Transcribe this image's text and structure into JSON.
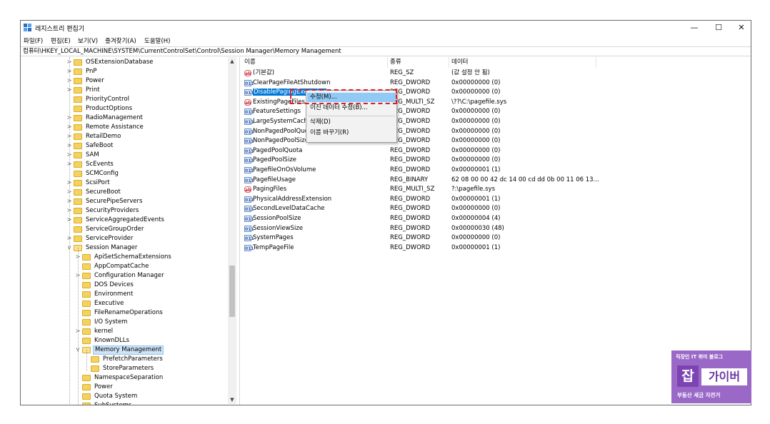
{
  "window": {
    "title": "레지스트리 편집기",
    "minimize": "—",
    "maximize": "☐",
    "close": "✕"
  },
  "menu": [
    "파일(F)",
    "편집(E)",
    "보기(V)",
    "즐겨찾기(A)",
    "도움말(H)"
  ],
  "address": "컴퓨터\\HKEY_LOCAL_MACHINE\\SYSTEM\\CurrentControlSet\\Control\\Session Manager\\Memory Management",
  "tree": [
    {
      "label": "OSExtensionDatabase",
      "level": 0,
      "chevron": ">"
    },
    {
      "label": "PnP",
      "level": 0,
      "chevron": ">"
    },
    {
      "label": "Power",
      "level": 0,
      "chevron": ">"
    },
    {
      "label": "Print",
      "level": 0,
      "chevron": ">"
    },
    {
      "label": "PriorityControl",
      "level": 0,
      "chevron": ""
    },
    {
      "label": "ProductOptions",
      "level": 0,
      "chevron": ""
    },
    {
      "label": "RadioManagement",
      "level": 0,
      "chevron": ">"
    },
    {
      "label": "Remote Assistance",
      "level": 0,
      "chevron": ">"
    },
    {
      "label": "RetailDemo",
      "level": 0,
      "chevron": ">"
    },
    {
      "label": "SafeBoot",
      "level": 0,
      "chevron": ">"
    },
    {
      "label": "SAM",
      "level": 0,
      "chevron": ">"
    },
    {
      "label": "ScEvents",
      "level": 0,
      "chevron": ">"
    },
    {
      "label": "SCMConfig",
      "level": 0,
      "chevron": ""
    },
    {
      "label": "ScsiPort",
      "level": 0,
      "chevron": ">"
    },
    {
      "label": "SecureBoot",
      "level": 0,
      "chevron": ">"
    },
    {
      "label": "SecurePipeServers",
      "level": 0,
      "chevron": ">"
    },
    {
      "label": "SecurityProviders",
      "level": 0,
      "chevron": ">"
    },
    {
      "label": "ServiceAggregatedEvents",
      "level": 0,
      "chevron": ">"
    },
    {
      "label": "ServiceGroupOrder",
      "level": 0,
      "chevron": ""
    },
    {
      "label": "ServiceProvider",
      "level": 0,
      "chevron": ">"
    },
    {
      "label": "Session Manager",
      "level": 0,
      "chevron": "v",
      "open": true
    },
    {
      "label": "ApiSetSchemaExtensions",
      "level": 1,
      "chevron": ">"
    },
    {
      "label": "AppCompatCache",
      "level": 1,
      "chevron": ""
    },
    {
      "label": "Configuration Manager",
      "level": 1,
      "chevron": ">"
    },
    {
      "label": "DOS Devices",
      "level": 1,
      "chevron": ""
    },
    {
      "label": "Environment",
      "level": 1,
      "chevron": ""
    },
    {
      "label": "Executive",
      "level": 1,
      "chevron": ""
    },
    {
      "label": "FileRenameOperations",
      "level": 1,
      "chevron": ""
    },
    {
      "label": "I/O System",
      "level": 1,
      "chevron": ""
    },
    {
      "label": "kernel",
      "level": 1,
      "chevron": ">"
    },
    {
      "label": "KnownDLLs",
      "level": 1,
      "chevron": ""
    },
    {
      "label": "Memory Management",
      "level": 1,
      "chevron": "v",
      "open": true,
      "selected": true
    },
    {
      "label": "PrefetchParameters",
      "level": 2,
      "chevron": ""
    },
    {
      "label": "StoreParameters",
      "level": 2,
      "chevron": ""
    },
    {
      "label": "NamespaceSeparation",
      "level": 1,
      "chevron": ""
    },
    {
      "label": "Power",
      "level": 1,
      "chevron": ""
    },
    {
      "label": "Quota System",
      "level": 1,
      "chevron": ""
    },
    {
      "label": "SubSystems",
      "level": 1,
      "chevron": ""
    }
  ],
  "columns": {
    "name": "이름",
    "type": "종류",
    "data": "데이터"
  },
  "values": [
    {
      "icon": "ab",
      "name": "(기본값)",
      "type": "REG_SZ",
      "data": "(값 설정 안 됨)"
    },
    {
      "icon": "bin",
      "name": "ClearPageFileAtShutdown",
      "type": "REG_DWORD",
      "data": "0x00000000 (0)"
    },
    {
      "icon": "bin",
      "name": "DisablePagingExecutive",
      "type": "REG_DWORD",
      "data": "0x00000000 (0)",
      "selected": true
    },
    {
      "icon": "ab",
      "name": "ExistingPageFiles",
      "type": "REG_MULTI_SZ",
      "data": "\\??\\C:\\pagefile.sys"
    },
    {
      "icon": "bin",
      "name": "FeatureSettings",
      "type": "REG_DWORD",
      "data": "0x00000000 (0)"
    },
    {
      "icon": "bin",
      "name": "LargeSystemCache",
      "type": "REG_DWORD",
      "data": "0x00000000 (0)"
    },
    {
      "icon": "bin",
      "name": "NonPagedPoolQuota",
      "type": "REG_DWORD",
      "data": "0x00000000 (0)"
    },
    {
      "icon": "bin",
      "name": "NonPagedPoolSize",
      "type": "REG_DWORD",
      "data": "0x00000000 (0)"
    },
    {
      "icon": "bin",
      "name": "PagedPoolQuota",
      "type": "REG_DWORD",
      "data": "0x00000000 (0)"
    },
    {
      "icon": "bin",
      "name": "PagedPoolSize",
      "type": "REG_DWORD",
      "data": "0x00000000 (0)"
    },
    {
      "icon": "bin",
      "name": "PagefileOnOsVolume",
      "type": "REG_DWORD",
      "data": "0x00000001 (1)"
    },
    {
      "icon": "bin",
      "name": "PagefileUsage",
      "type": "REG_BINARY",
      "data": "62 08 00 00 42 dc 14 00 cd dd 0b 00 11 06 13..."
    },
    {
      "icon": "ab",
      "name": "PagingFiles",
      "type": "REG_MULTI_SZ",
      "data": "?:\\pagefile.sys"
    },
    {
      "icon": "bin",
      "name": "PhysicalAddressExtension",
      "type": "REG_DWORD",
      "data": "0x00000001 (1)"
    },
    {
      "icon": "bin",
      "name": "SecondLevelDataCache",
      "type": "REG_DWORD",
      "data": "0x00000000 (0)"
    },
    {
      "icon": "bin",
      "name": "SessionPoolSize",
      "type": "REG_DWORD",
      "data": "0x00000004 (4)"
    },
    {
      "icon": "bin",
      "name": "SessionViewSize",
      "type": "REG_DWORD",
      "data": "0x00000030 (48)"
    },
    {
      "icon": "bin",
      "name": "SystemPages",
      "type": "REG_DWORD",
      "data": "0x00000000 (0)"
    },
    {
      "icon": "bin",
      "name": "TempPageFile",
      "type": "REG_DWORD",
      "data": "0x00000001 (1)"
    }
  ],
  "context_menu": [
    {
      "label": "수정(M)...",
      "highlight": true
    },
    {
      "label": "이진 데이터 수정(B)..."
    },
    {
      "separator": true
    },
    {
      "label": "삭제(D)"
    },
    {
      "label": "이름 바꾸기(R)"
    }
  ],
  "icons": {
    "string": "ab",
    "binary": "011"
  },
  "scroll": {
    "up": "▲",
    "down": "▼"
  },
  "watermark": {
    "top": "직장인 IT 취미 블로그",
    "logo": "잡",
    "name": "가이버",
    "bottom": "부동산 세금 자전거"
  },
  "colors": {
    "selection": "#0078d7",
    "menu_highlight": "#91c9f7",
    "highlight_box": "#d6202a",
    "watermark_bg": "#9a68c7"
  }
}
